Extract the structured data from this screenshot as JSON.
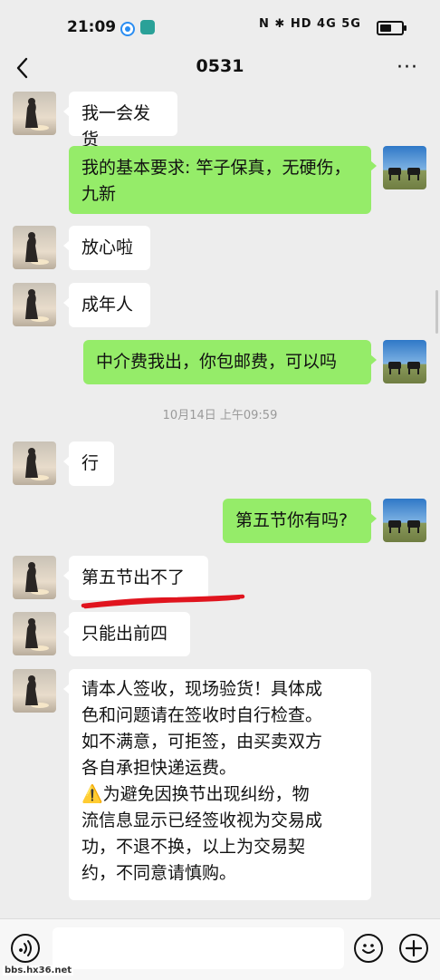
{
  "status_bar": {
    "time": "21:09",
    "right_indicators": "N ✱ HD 4G 5G",
    "battery_icon": "battery-icon"
  },
  "header": {
    "title": "0531",
    "back_icon": "chevron-left-icon",
    "more_icon": "more-dots-icon",
    "more_glyph": "···"
  },
  "messages": [
    {
      "side": "in",
      "text": "我一会发货"
    },
    {
      "side": "out",
      "lines": [
        "我的基本要求: 竿子保真，无硬伤，",
        "九新"
      ]
    },
    {
      "side": "in",
      "text": "放心啦"
    },
    {
      "side": "in",
      "text": "成年人"
    },
    {
      "side": "out",
      "text": "中介费我出，你包邮费，可以吗"
    },
    {
      "side": "in",
      "text": "行"
    },
    {
      "side": "out",
      "text": "第五节你有吗?"
    },
    {
      "side": "in",
      "text": "第五节出不了"
    },
    {
      "side": "in",
      "text": "只能出前四"
    },
    {
      "side": "in",
      "lines": [
        "请本人签收，现场验货！具体成",
        "色和问题请在签收时自行检查。",
        "如不满意，可拒签，由买卖双方",
        "各自承担快递运费。",
        "⚠️为避免因换节出现纠纷，物",
        "流信息显示已经签收视为交易成",
        "功，不退不换，以上为交易契",
        "约，不同意请慎购。"
      ]
    }
  ],
  "timestamp": "10月14日 上午09:59",
  "input": {
    "value": "",
    "placeholder": ""
  },
  "watermark": "bbs.hx36.net",
  "colors": {
    "background": "#ededed",
    "outgoing_bubble": "#95ec69",
    "incoming_bubble": "#ffffff",
    "annotation": "#e0141e"
  }
}
